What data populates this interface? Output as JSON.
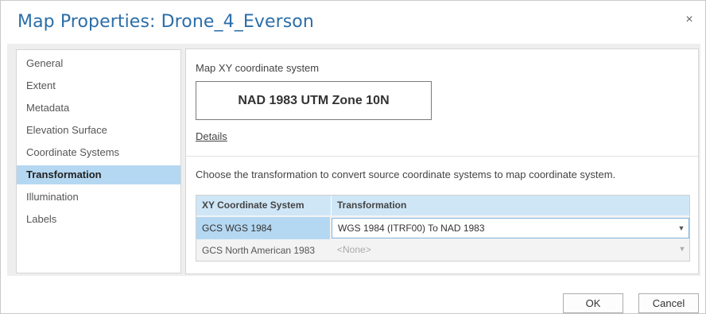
{
  "dialog": {
    "title": "Map Properties: Drone_4_Everson",
    "close_glyph": "×"
  },
  "nav": {
    "items": [
      {
        "label": "General"
      },
      {
        "label": "Extent"
      },
      {
        "label": "Metadata"
      },
      {
        "label": "Elevation Surface"
      },
      {
        "label": "Coordinate Systems"
      },
      {
        "label": "Transformation"
      },
      {
        "label": "Illumination"
      },
      {
        "label": "Labels"
      }
    ],
    "active": "Transformation"
  },
  "content": {
    "map_xy_label": "Map XY coordinate system",
    "current_crs": "NAD 1983 UTM Zone 10N",
    "details_link": "Details",
    "instruction": "Choose the transformation to convert source coordinate systems to map coordinate system.",
    "grid": {
      "columns": [
        "XY Coordinate System",
        "Transformation"
      ],
      "rows": [
        {
          "system": "GCS WGS 1984",
          "transformation": "WGS 1984 (ITRF00) To NAD 1983",
          "selected": true
        },
        {
          "system": "GCS North American 1983",
          "transformation": "<None>",
          "selected": false
        }
      ]
    }
  },
  "buttons": {
    "ok": "OK",
    "cancel": "Cancel"
  },
  "colors": {
    "title_blue": "#2b6ea8",
    "selection_blue": "#b5d8f2",
    "header_blue": "#cfe6f7"
  },
  "icons": {
    "close": "close-icon",
    "dropdown": "chevron-down-icon"
  }
}
